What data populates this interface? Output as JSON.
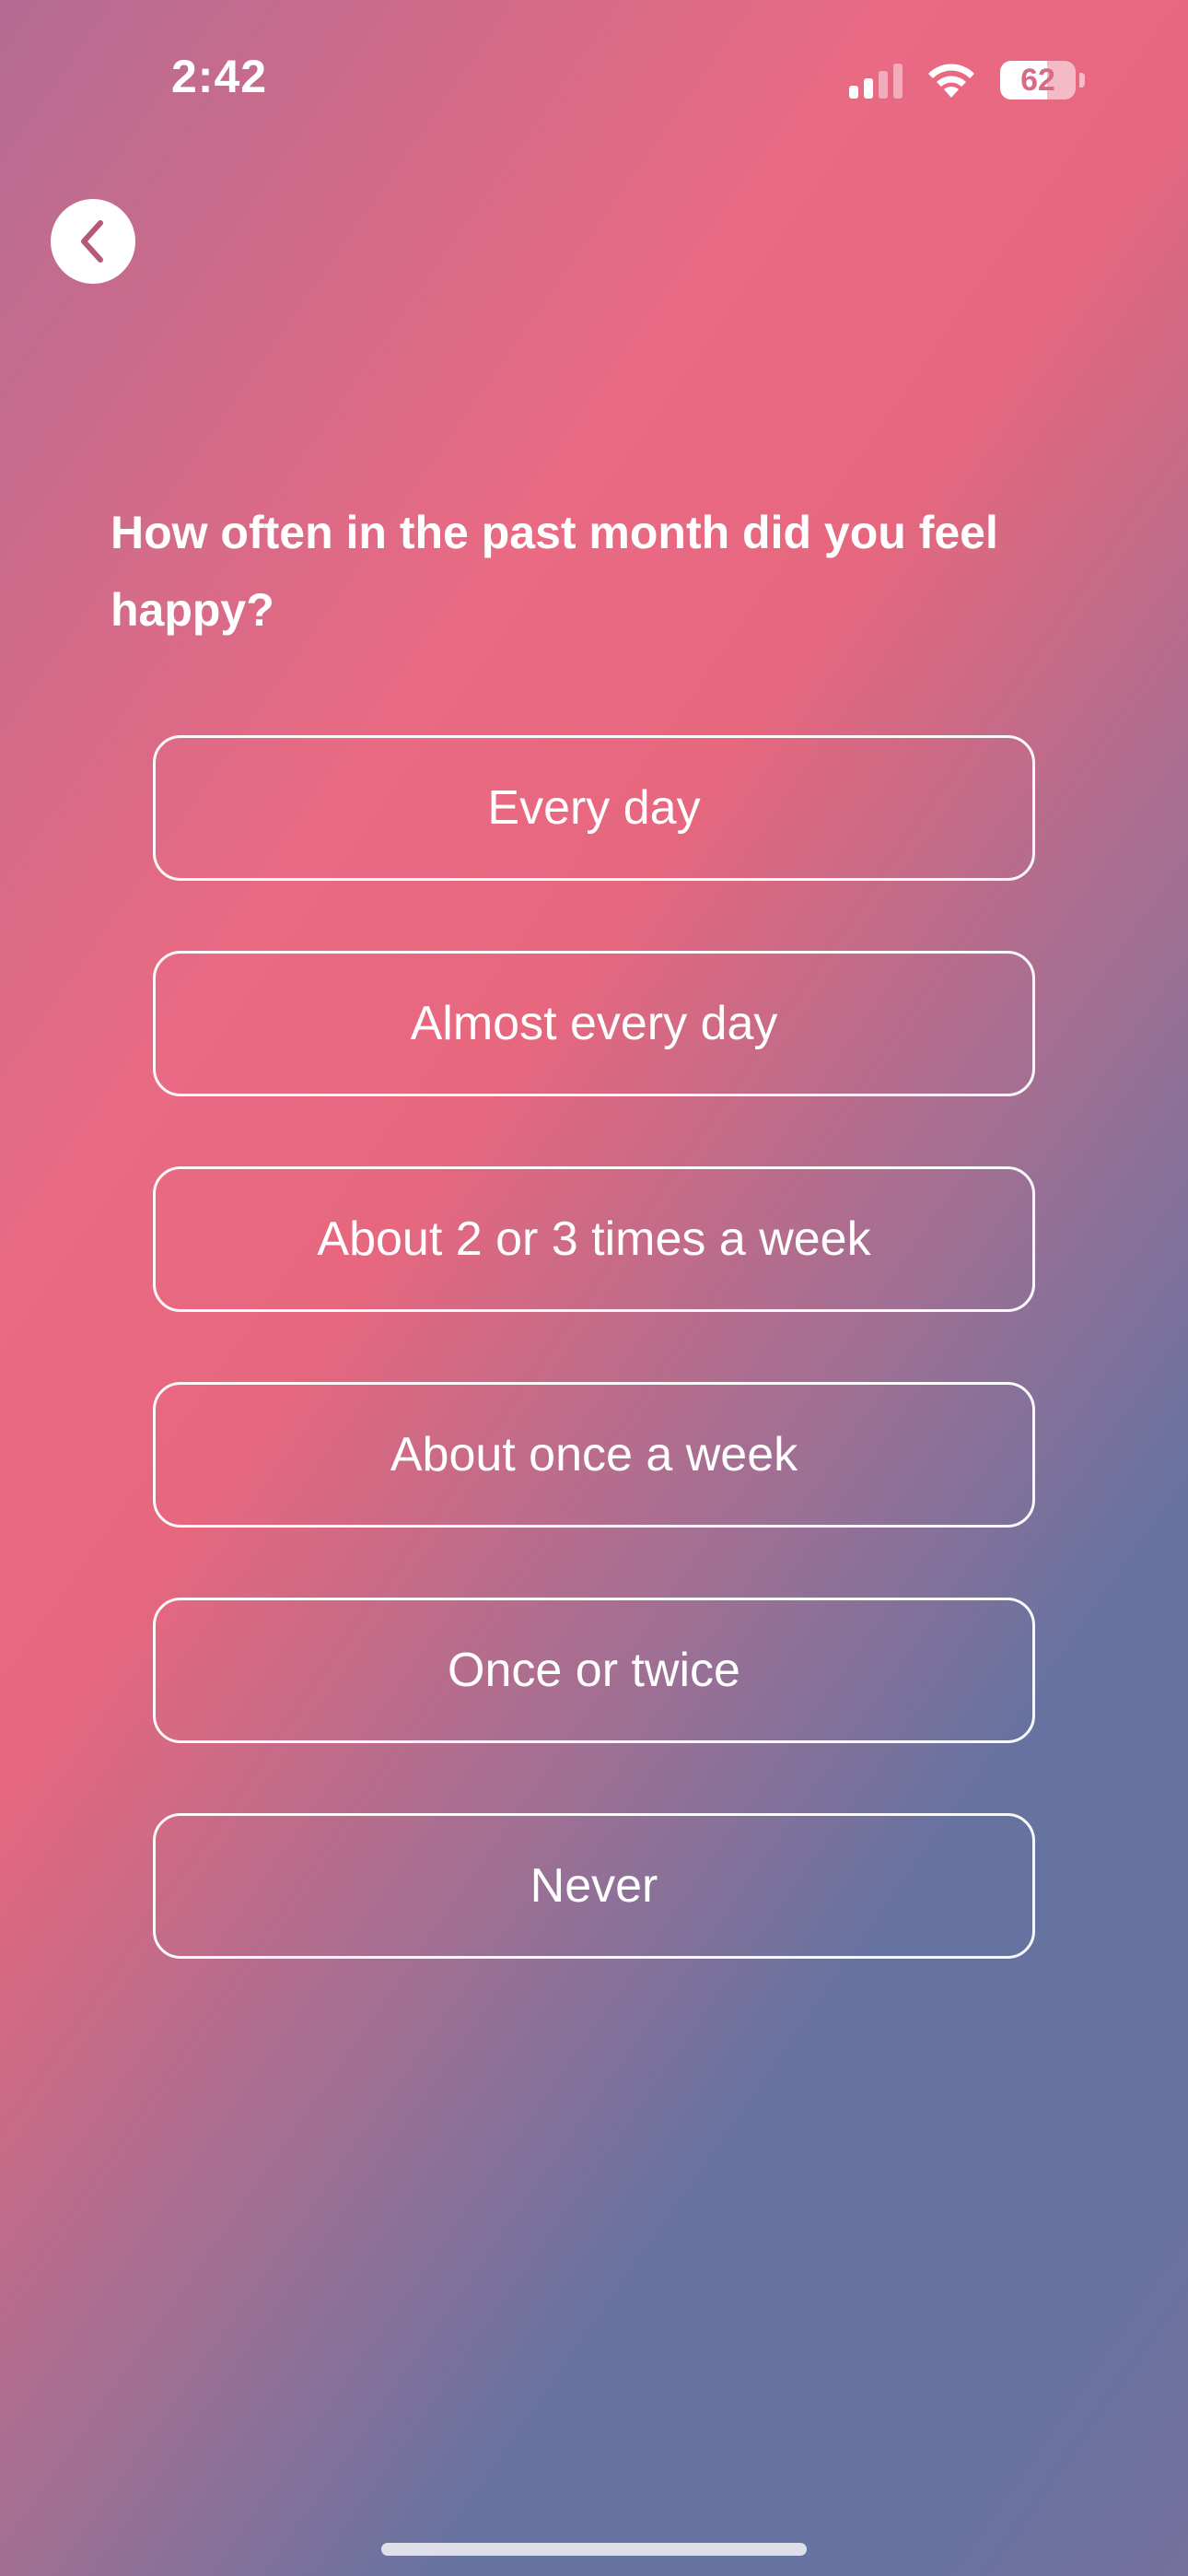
{
  "status_bar": {
    "time": "2:42",
    "battery_level": "62",
    "battery_fraction": 0.62,
    "signal_bars_active": 2,
    "signal_bars_total": 4
  },
  "nav": {
    "back_icon": "chevron-left-icon"
  },
  "question": {
    "text": "How often in the past month did you feel happy?"
  },
  "options": [
    {
      "label": "Every day"
    },
    {
      "label": "Almost every day"
    },
    {
      "label": "About 2 or 3 times a week"
    },
    {
      "label": "About once a week"
    },
    {
      "label": "Once or twice"
    },
    {
      "label": "Never"
    }
  ],
  "colors": {
    "gradient_pink": "#e96a83",
    "gradient_blue": "#6672a0",
    "accent_chevron": "#b5587b"
  }
}
